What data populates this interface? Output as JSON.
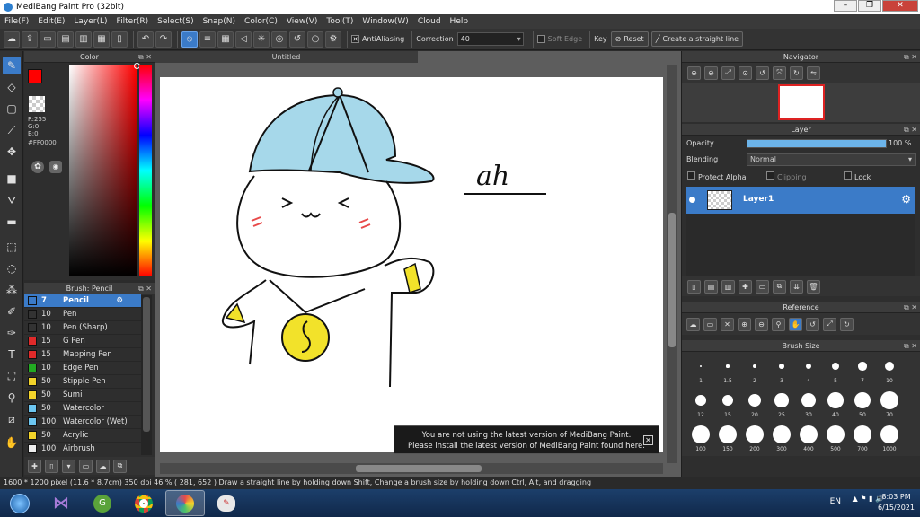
{
  "window": {
    "title": "MediBang Paint Pro (32bit)",
    "buttons": [
      "–",
      "❐",
      "✕"
    ]
  },
  "menu": [
    "File(F)",
    "Edit(E)",
    "Layer(L)",
    "Filter(R)",
    "Select(S)",
    "Snap(N)",
    "Color(C)",
    "View(V)",
    "Tool(T)",
    "Window(W)",
    "Cloud",
    "Help"
  ],
  "toolbar": {
    "antialiasing_label": "AntiAliasing",
    "correction_label": "Correction",
    "correction_value": "40",
    "soft_edge_label": "Soft Edge",
    "key_label": "Key",
    "reset_label": "Reset",
    "straight_line_label": "Create a straight line"
  },
  "color_panel": {
    "title": "Color",
    "current_color": "#FF0000",
    "r_label": "R:255",
    "g_label": "G:0",
    "b_label": "B:0",
    "hex_label": "#FF0000"
  },
  "brush_panel": {
    "title": "Brush: Pencil",
    "brushes": [
      {
        "size": "7",
        "name": "Pencil",
        "color": "#3b7bc8",
        "selected": true
      },
      {
        "size": "10",
        "name": "Pen",
        "color": "#333333"
      },
      {
        "size": "10",
        "name": "Pen (Sharp)",
        "color": "#333333"
      },
      {
        "size": "15",
        "name": "G Pen",
        "color": "#e02a2a"
      },
      {
        "size": "15",
        "name": "Mapping Pen",
        "color": "#e02a2a"
      },
      {
        "size": "10",
        "name": "Edge Pen",
        "color": "#22aa22"
      },
      {
        "size": "50",
        "name": "Stipple Pen",
        "color": "#f2d32a"
      },
      {
        "size": "50",
        "name": "Sumi",
        "color": "#f2d32a"
      },
      {
        "size": "50",
        "name": "Watercolor",
        "color": "#6cc6f0"
      },
      {
        "size": "100",
        "name": "Watercolor (Wet)",
        "color": "#6cc6f0"
      },
      {
        "size": "50",
        "name": "Acrylic",
        "color": "#f2d32a"
      },
      {
        "size": "100",
        "name": "Airbrush",
        "color": "#eeeeee"
      }
    ]
  },
  "canvas": {
    "tab_title": "Untitled",
    "drawing_text": "ah",
    "notice_line1": "You are not using the latest version of MediBang Paint.",
    "notice_line2": "Please install the latest version of MediBang Paint found here.",
    "notice_close": "✕"
  },
  "navigator": {
    "title": "Navigator"
  },
  "layer_panel": {
    "title": "Layer",
    "opacity_label": "Opacity",
    "opacity_value": "100 %",
    "opacity_percent": 100,
    "blending_label": "Blending",
    "blending_value": "Normal",
    "protect_alpha_label": "Protect Alpha",
    "clipping_label": "Clipping",
    "lock_label": "Lock",
    "layers": [
      {
        "name": "Layer1"
      }
    ]
  },
  "reference": {
    "title": "Reference"
  },
  "brush_size": {
    "title": "Brush Size",
    "sizes": [
      "1",
      "1.5",
      "2",
      "3",
      "4",
      "5",
      "7",
      "10",
      "12",
      "15",
      "20",
      "25",
      "30",
      "40",
      "50",
      "70",
      "100",
      "150",
      "200",
      "300",
      "400",
      "500",
      "700",
      "1000"
    ]
  },
  "status": {
    "text": "1600 * 1200 pixel   (11.6 * 8.7cm)   350 dpi   46 %   ( 281, 652 )   Draw a straight line by holding down Shift, Change a brush size by holding down Ctrl, Alt, and dragging"
  },
  "taskbar": {
    "language": "EN",
    "time": "8:03 PM",
    "date": "6/15/2021"
  }
}
